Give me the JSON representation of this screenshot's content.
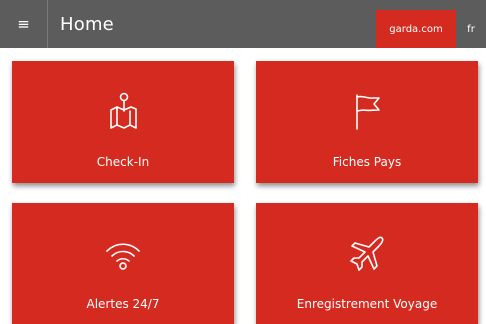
{
  "header": {
    "menu_icon": "hamburger-icon",
    "title": "Home",
    "link_label": "garda.com",
    "lang_label": "fr"
  },
  "tiles": [
    {
      "label": "Check-In",
      "icon": "map-pin-icon"
    },
    {
      "label": "Fiches Pays",
      "icon": "flag-icon"
    },
    {
      "label": "Alertes 24/7",
      "icon": "wifi-icon"
    },
    {
      "label": "Enregistrement Voyage",
      "icon": "airplane-icon"
    }
  ],
  "colors": {
    "header_bg": "#5c5c5c",
    "accent": "#d42a1f",
    "text": "#ffffff"
  }
}
